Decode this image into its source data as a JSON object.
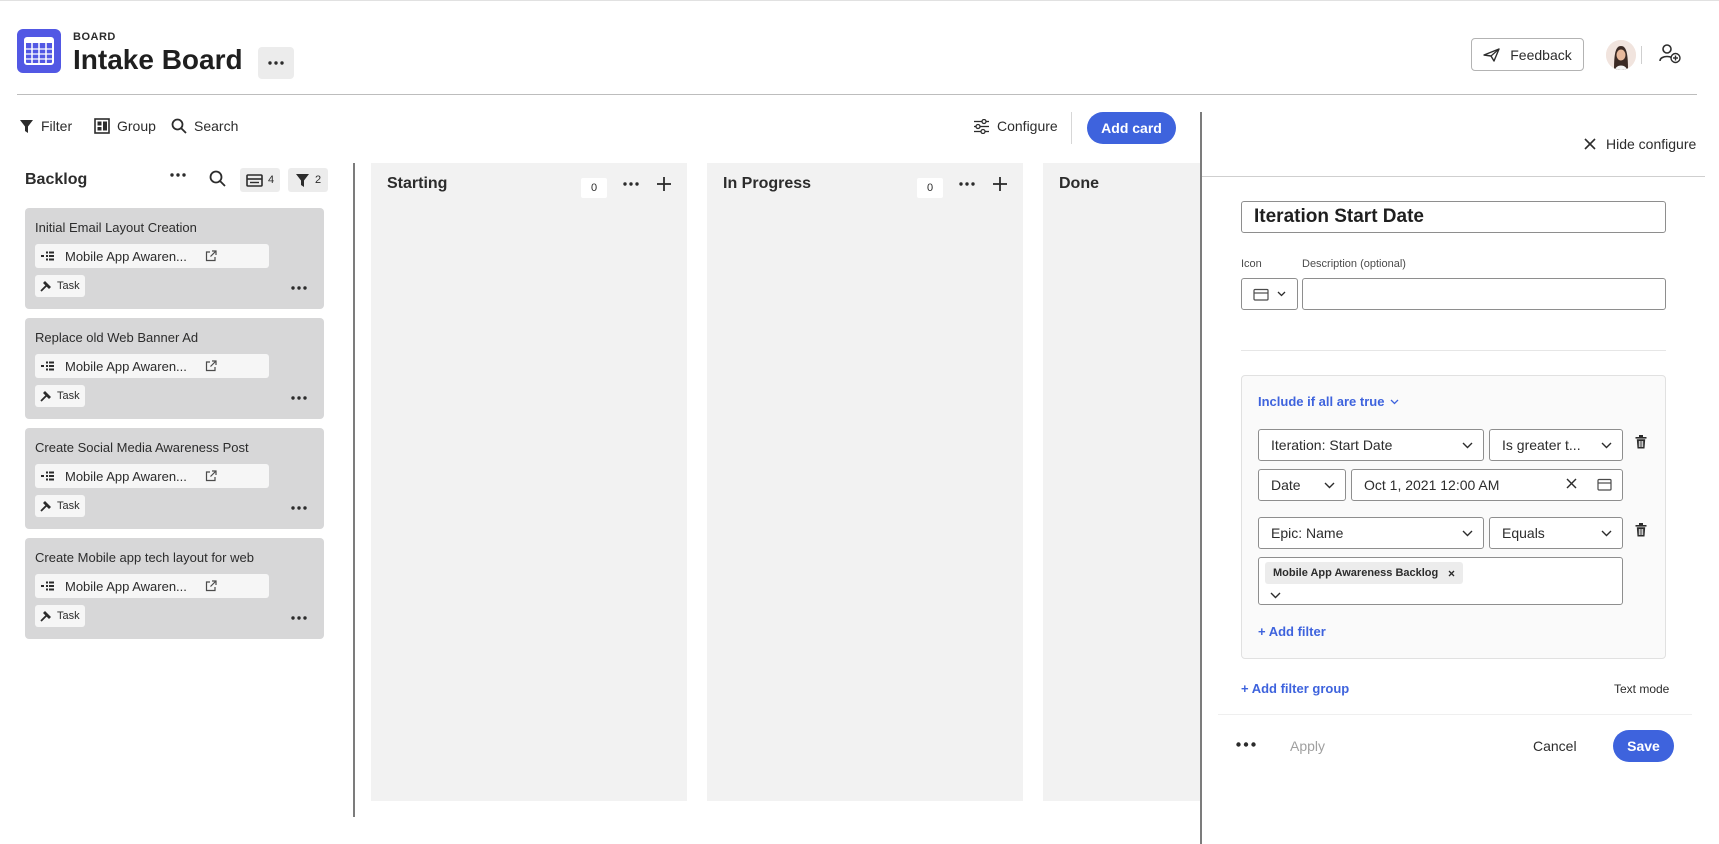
{
  "header": {
    "kicker": "BOARD",
    "title": "Intake Board",
    "feedback_label": "Feedback"
  },
  "toolbar": {
    "filter_label": "Filter",
    "group_label": "Group",
    "search_label": "Search",
    "configure_label": "Configure",
    "add_card_label": "Add card"
  },
  "backlog": {
    "title": "Backlog",
    "card_count": "4",
    "filter_count": "2",
    "cards": [
      {
        "title": "Initial Email Layout Creation",
        "epic": "Mobile App Awaren...",
        "type": "Task"
      },
      {
        "title": "Replace old Web Banner Ad",
        "epic": "Mobile App Awaren...",
        "type": "Task"
      },
      {
        "title": "Create Social Media Awareness Post",
        "epic": "Mobile App Awaren...",
        "type": "Task"
      },
      {
        "title": "Create Mobile app tech layout for web",
        "epic": "Mobile App Awaren...",
        "type": "Task"
      }
    ]
  },
  "columns": [
    {
      "title": "Starting",
      "count": "0"
    },
    {
      "title": "In Progress",
      "count": "0"
    },
    {
      "title": "Done"
    }
  ],
  "config": {
    "hide_label": "Hide configure",
    "name_value": "Iteration Start Date",
    "icon_label": "Icon",
    "description_label": "Description (optional)",
    "description_value": "",
    "include_mode": "Include if all are true",
    "filter1": {
      "field": "Iteration: Start Date",
      "operator": "Is greater t...",
      "value_type": "Date",
      "value": "Oct 1, 2021 12:00 AM"
    },
    "filter2": {
      "field": "Epic: Name",
      "operator": "Equals",
      "tag": "Mobile App Awareness Backlog"
    },
    "add_filter_label": "+ Add filter",
    "add_filter_group_label": "+ Add filter group",
    "text_mode_label": "Text mode",
    "apply_label": "Apply",
    "cancel_label": "Cancel",
    "save_label": "Save"
  },
  "colors": {
    "accent": "#3e63dd",
    "logo": "#5258e4",
    "card": "#d7d7d8",
    "column": "#f2f2f2"
  },
  "icons": [
    "board-logo-icon",
    "more-icon",
    "send-icon",
    "add-user-icon",
    "filter-icon",
    "group-icon",
    "search-icon",
    "settings-sliders-icon",
    "card-stack-icon",
    "epic-icon",
    "external-link-icon",
    "task-icon",
    "plus-icon",
    "close-icon",
    "calendar-icon",
    "chevron-down-icon",
    "trash-icon"
  ]
}
